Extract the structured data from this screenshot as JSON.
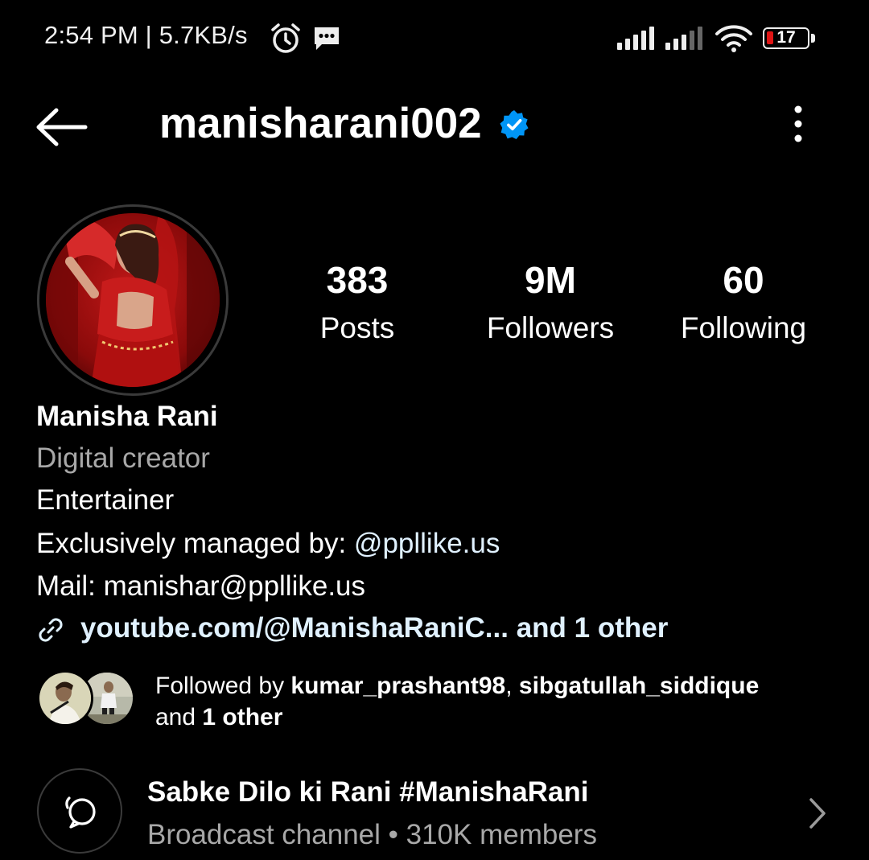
{
  "status_bar": {
    "time_speed": "2:54 PM | 5.7KB/s",
    "battery_level": "17",
    "battery_fraction": 0.17,
    "icons": [
      "alarm-icon",
      "message-icon",
      "signal-icon",
      "signal-icon",
      "wifi-icon",
      "battery-icon"
    ]
  },
  "header": {
    "username": "manisharani002",
    "verified": true,
    "icons": [
      "arrow-left-icon",
      "verified-badge-icon",
      "more-vertical-icon"
    ]
  },
  "stats": {
    "posts": {
      "value": "383",
      "label": "Posts"
    },
    "followers": {
      "value": "9M",
      "label": "Followers"
    },
    "following": {
      "value": "60",
      "label": "Following"
    }
  },
  "bio": {
    "name": "Manisha Rani",
    "category": "Digital creator",
    "line1": "Entertainer",
    "line2_prefix": "Exclusively managed by: ",
    "line2_mention": "@ppllike.us",
    "line3": "Mail: manishar@ppllike.us",
    "link": "youtube.com/@ManishaRaniC... and 1 other",
    "link_icon": "link-icon"
  },
  "followed_by": {
    "prefix": "Followed by ",
    "user1": "kumar_prashant98",
    "separator": ", ",
    "user2": "sibgatullah_siddique",
    "and_text": "and ",
    "others": "1 other"
  },
  "channel": {
    "title": "Sabke Dilo ki Rani #ManishaRani",
    "subtitle": "Broadcast channel • 310K members",
    "icons": [
      "broadcast-channel-icon",
      "chevron-right-icon"
    ]
  },
  "colors": {
    "background": "#000000",
    "text": "#ffffff",
    "secondary_text": "#a8a8a8",
    "link": "#e0f1ff",
    "verified_blue": "#0095f6",
    "battery_low": "#e01515"
  }
}
